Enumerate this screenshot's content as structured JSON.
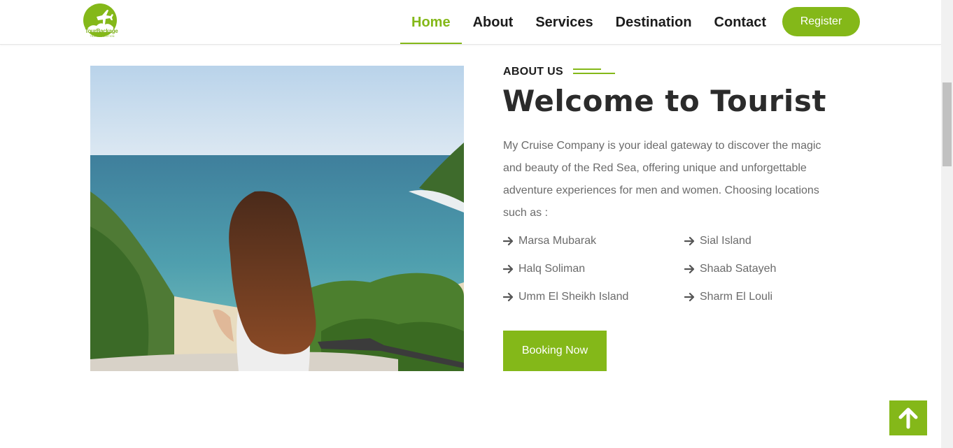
{
  "header": {
    "logo": {
      "text": "TourBackage",
      "tagline": "TRAVEL SOLUTION",
      "icon": "airplane-logo-icon"
    },
    "nav": [
      {
        "label": "Home",
        "active": true
      },
      {
        "label": "About",
        "active": false
      },
      {
        "label": "Services",
        "active": false
      },
      {
        "label": "Destination",
        "active": false
      },
      {
        "label": "Contact",
        "active": false
      }
    ],
    "register_label": "Register"
  },
  "about": {
    "label": "ABOUT US",
    "title": "Welcome to Tourist",
    "description": "My Cruise Company is your ideal gateway to discover the magic and beauty of the Red Sea, offering unique and unforgettable adventure experiences for men and women. Choosing locations such as :",
    "locations": [
      "Marsa Mubarak",
      "Sial Island",
      "Halq Soliman",
      "Shaab Satayeh",
      "Umm El Sheikh Island",
      "Sharm El Louli"
    ],
    "booking_label": "Booking Now"
  },
  "back_to_top": {
    "icon": "arrow-up-icon"
  },
  "colors": {
    "accent": "#84b819",
    "text_dark": "#2b2b2b",
    "text_muted": "#6b6b6b"
  }
}
